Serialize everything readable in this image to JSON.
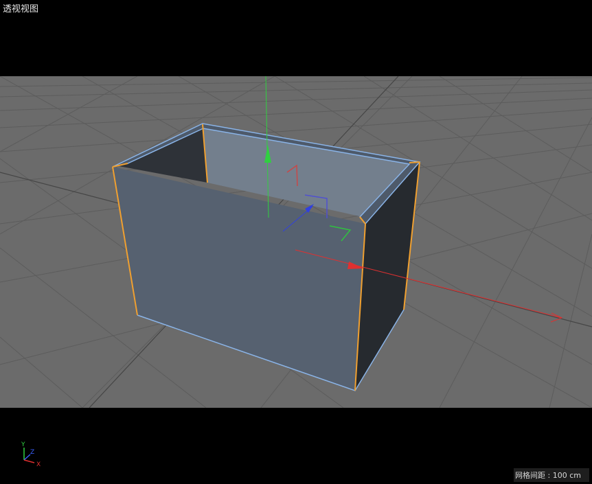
{
  "viewport": {
    "title": "透视视图",
    "grid_spacing_label": "网格间距",
    "grid_spacing_value": "100 cm"
  },
  "axis_gizmo": {
    "y_label": "Y",
    "z_label": "Z",
    "x_label": "X"
  },
  "colors": {
    "background": "#000000",
    "floor": "#6b6b6b",
    "grid_line": "#5a5a5a",
    "object_face": "#566170",
    "object_dark": "#262a2f",
    "selection_edge": "#f0a030",
    "highlight_edge": "#8ab4e8",
    "axis_x": "#e03030",
    "axis_y": "#30d040",
    "axis_z": "#3040e0"
  },
  "icons": [
    "move-gizmo-icon",
    "rotate-gizmo-icon",
    "axis-orientation-icon"
  ]
}
